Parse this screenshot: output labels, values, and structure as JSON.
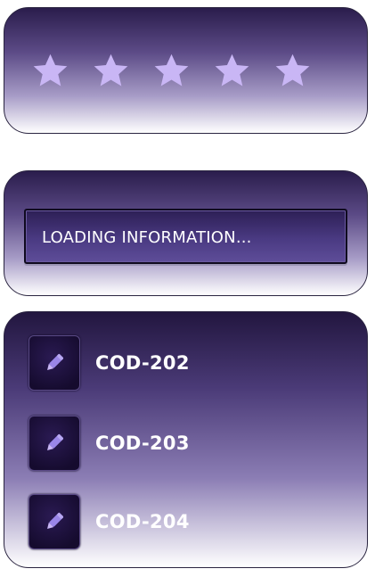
{
  "rating": {
    "value": 5,
    "max": 5,
    "star_color": "#c9b6f5"
  },
  "loading": {
    "text": "LOADING INFORMATION..."
  },
  "items": [
    {
      "label": "COD-202",
      "icon": "pencil-icon"
    },
    {
      "label": "COD-203",
      "icon": "pencil-icon"
    },
    {
      "label": "COD-204",
      "icon": "pencil-icon"
    }
  ],
  "colors": {
    "accent": "#c9b6f5",
    "card_dark": "#2a1d4c"
  }
}
